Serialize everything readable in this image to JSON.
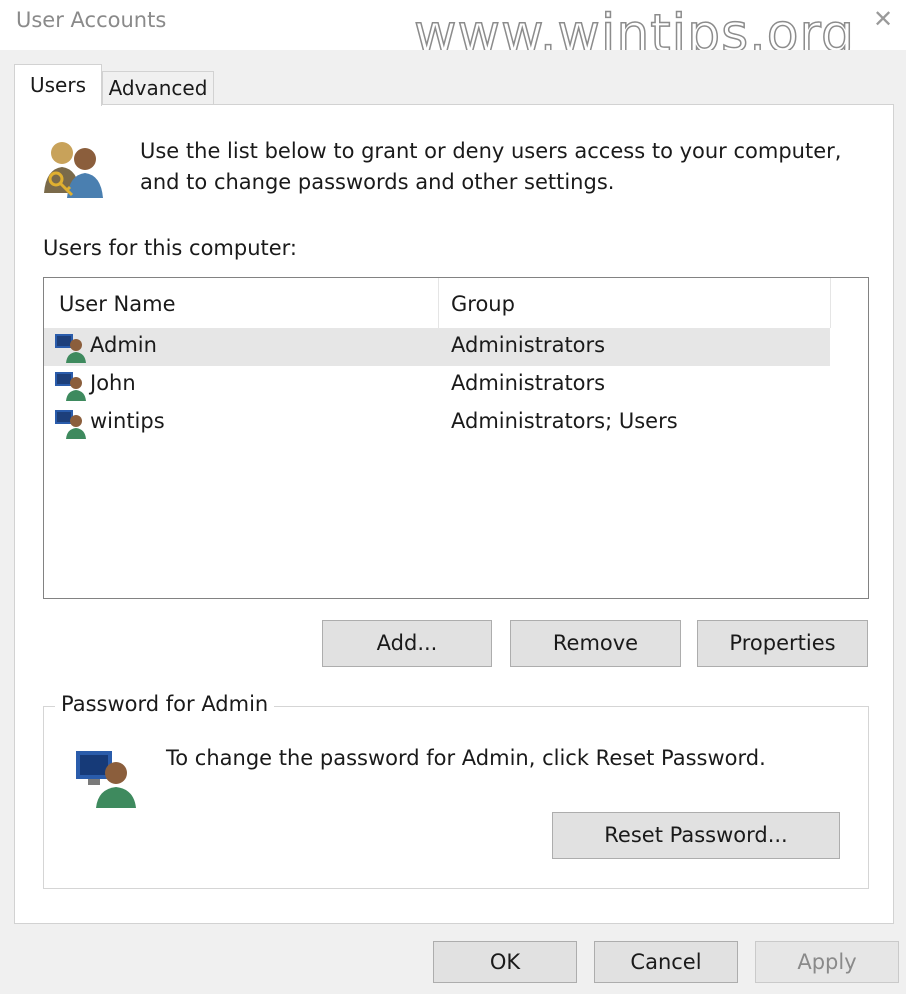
{
  "window": {
    "title": "User Accounts",
    "close_glyph": "✕",
    "watermark": "www.wintips.org"
  },
  "tabs": [
    {
      "label": "Users",
      "active": true
    },
    {
      "label": "Advanced",
      "active": false
    }
  ],
  "intro": {
    "icon": "users-key-icon",
    "line1": "Use the list below to grant or deny users access to your computer,",
    "line2": "and to change passwords and other settings."
  },
  "users_label": "Users for this computer:",
  "list": {
    "columns": [
      "User Name",
      "Group"
    ],
    "rows": [
      {
        "name": "Admin",
        "group": "Administrators",
        "selected": true
      },
      {
        "name": "John",
        "group": "Administrators",
        "selected": false
      },
      {
        "name": "wintips",
        "group": "Administrators; Users",
        "selected": false
      }
    ]
  },
  "buttons": {
    "add": "Add...",
    "remove": "Remove",
    "properties": "Properties",
    "reset_password": "Reset Password...",
    "ok": "OK",
    "cancel": "Cancel",
    "apply": "Apply"
  },
  "password_group": {
    "legend": "Password for Admin",
    "text": "To change the password for Admin, click Reset Password.",
    "icon": "user-monitor-icon"
  },
  "colors": {
    "panel": "#ffffff",
    "dialog_bg": "#f0f0f0",
    "button": "#e1e1e1",
    "selection": "#e6e6e6"
  }
}
